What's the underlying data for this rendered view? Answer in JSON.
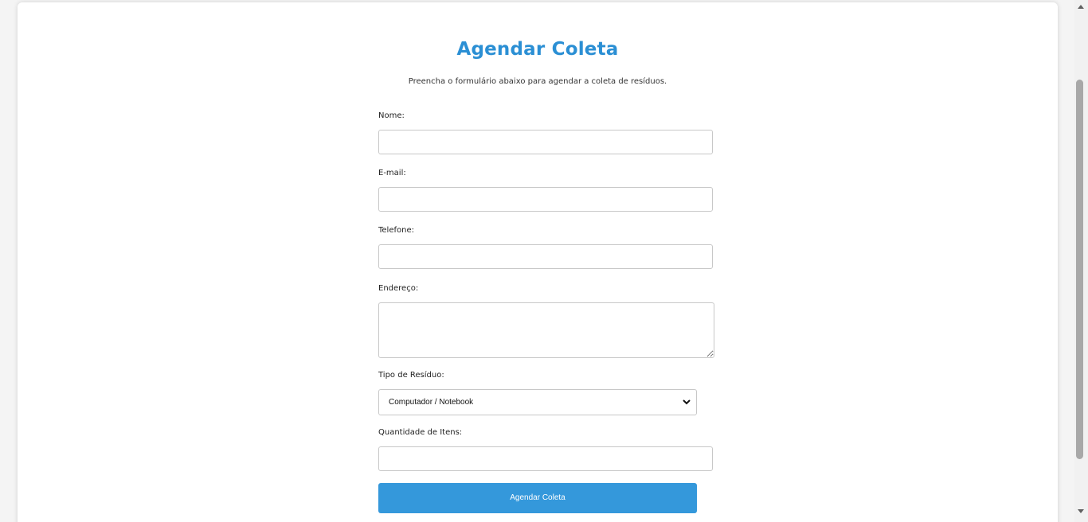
{
  "page": {
    "title": "Agendar Coleta",
    "subtitle": "Preencha o formulário abaixo para agendar a coleta de resíduos."
  },
  "form": {
    "nome_label": "Nome:",
    "nome_value": "",
    "email_label": "E-mail:",
    "email_value": "",
    "telefone_label": "Telefone:",
    "telefone_value": "",
    "endereco_label": "Endereço:",
    "endereco_value": "",
    "tipo_label": "Tipo de Resíduo:",
    "tipo_selected": "Computador / Notebook",
    "quantidade_label": "Quantidade de Itens:",
    "quantidade_value": "",
    "submit_label": "Agendar Coleta"
  },
  "colors": {
    "accent": "#3498db",
    "title": "#2b8fd4"
  }
}
